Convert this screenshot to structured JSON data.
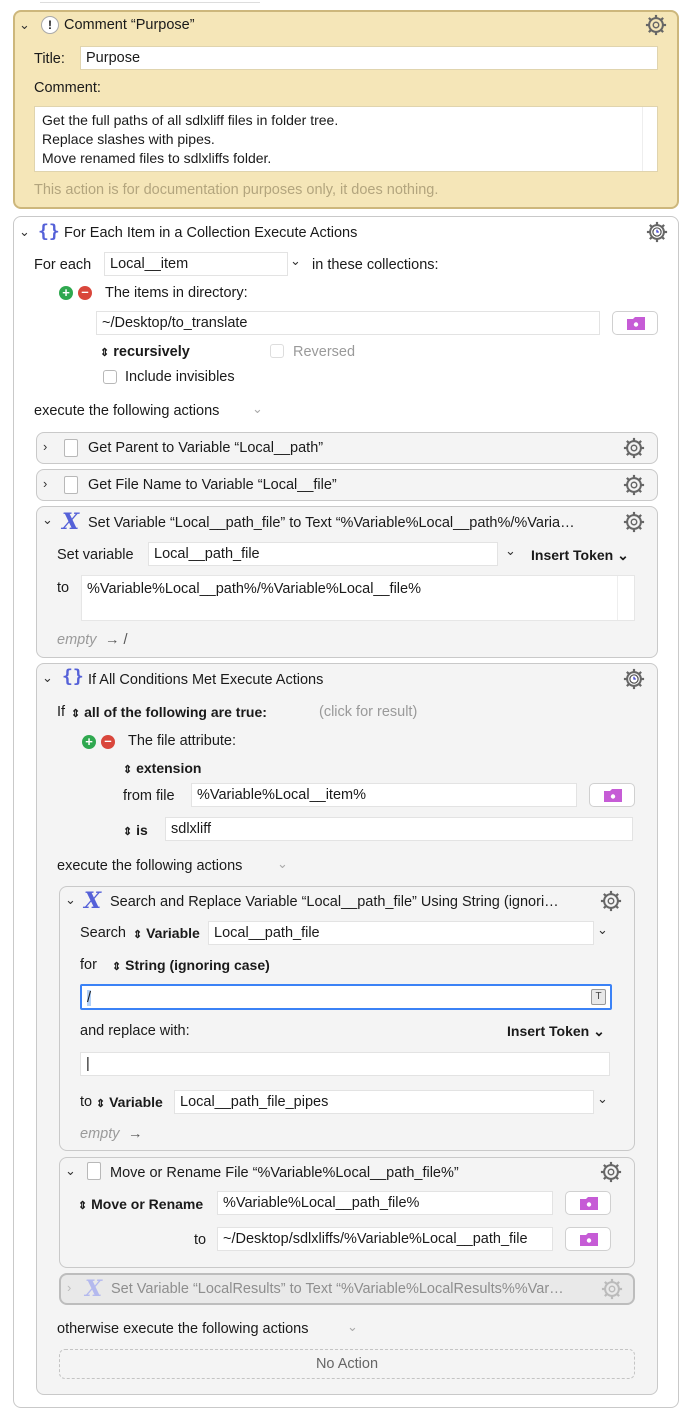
{
  "comment_action": {
    "title": "Comment “Purpose”",
    "title_label": "Title:",
    "title_value": "Purpose",
    "comment_label": "Comment:",
    "comment_lines": [
      "Get the full paths of all sdlxliff files in folder tree.",
      "Replace slashes with pipes.",
      "Move renamed files to sdlxliffs folder."
    ],
    "footer": "This action is for documentation purposes only, it does nothing."
  },
  "for_each": {
    "title": "For Each Item in a Collection Execute Actions",
    "for_each_label": "For each",
    "variable": "Local__item",
    "in_collections": "in these collections:",
    "collection_label": "The items in directory:",
    "directory": "~/Desktop/to_translate",
    "recursively": "recursively",
    "reversed": "Reversed",
    "include_invisibles": "Include invisibles",
    "execute_label": "execute the following actions"
  },
  "get_parent": {
    "title": "Get Parent to Variable “Local__path”"
  },
  "get_filename": {
    "title": "Get File Name to Variable “Local__file”"
  },
  "set_variable": {
    "title": "Set Variable “Local__path_file” to Text “%Variable%Local__path%/%Varia…",
    "set_label": "Set variable",
    "variable": "Local__path_file",
    "insert_token": "Insert Token",
    "to_label": "to",
    "text": "%Variable%Local__path%/%Variable%Local__file%",
    "empty_hint": "empty",
    "empty_arrow": "→ /"
  },
  "if_action": {
    "title": "If All Conditions Met Execute Actions",
    "if_label": "If",
    "condition_mode": "all of the following are true:",
    "click_hint": "(click for result)",
    "condition_label": "The file attribute:",
    "attribute": "extension",
    "from_file_label": "from file",
    "from_file": "%Variable%Local__item%",
    "is_label": "is",
    "is_value": "sdlxliff",
    "execute_label": "execute the following actions",
    "otherwise_label": "otherwise execute the following actions",
    "no_action": "No Action"
  },
  "search_replace": {
    "title": "Search and Replace Variable “Local__path_file” Using String (ignori…",
    "search_label": "Search",
    "search_type": "Variable",
    "search_var": "Local__path_file",
    "for_label": "for",
    "for_mode": "String (ignoring case)",
    "search_text": "/",
    "t_badge": "T",
    "replace_label": "and replace with:",
    "insert_token": "Insert Token",
    "replace_text": "|",
    "to_label": "to",
    "to_type": "Variable",
    "to_var": "Local__path_file_pipes",
    "empty_hint": "empty",
    "empty_arrow": "→"
  },
  "move_rename": {
    "title": "Move or Rename File “%Variable%Local__path_file%”",
    "mode": "Move or Rename",
    "source": "%Variable%Local__path_file%",
    "to_label": "to",
    "dest": "~/Desktop/sdlxliffs/%Variable%Local__path_file"
  },
  "disabled_set": {
    "title": "Set Variable “LocalResults” to Text “%Variable%LocalResults%%Var…"
  },
  "colors": {
    "accent_purple": "#5561d8",
    "comment_bg": "#f5e6b8",
    "folder_magenta": "#c65cd6",
    "focus_blue": "#3b82f6"
  }
}
